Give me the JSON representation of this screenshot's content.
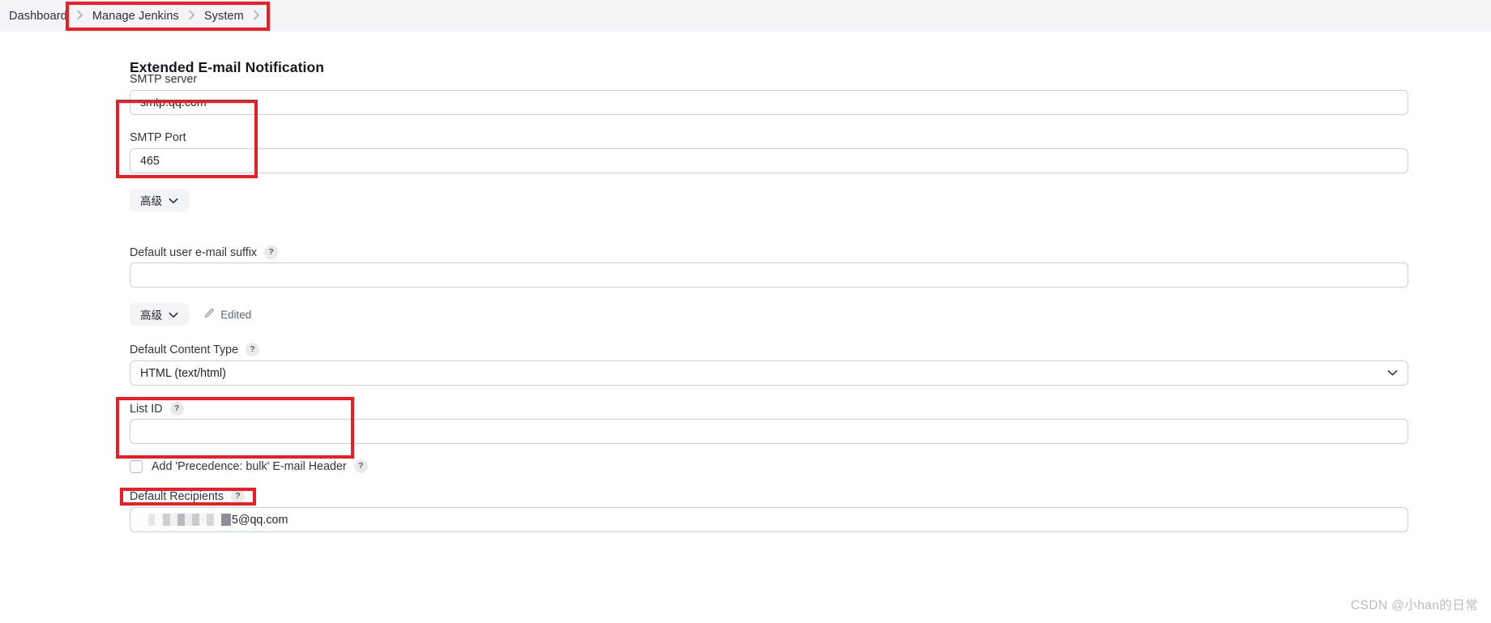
{
  "breadcrumb": {
    "items": [
      {
        "label": "Dashboard"
      },
      {
        "label": "Manage Jenkins"
      },
      {
        "label": "System"
      }
    ],
    "separator_icon": "chevron-right-icon"
  },
  "page": {
    "title": "Extended E-mail Notification"
  },
  "form": {
    "smtp_server": {
      "label": "SMTP server",
      "value": "smtp.qq.com",
      "placeholder": ""
    },
    "smtp_port": {
      "label": "SMTP Port",
      "value": "465",
      "placeholder": ""
    },
    "advanced_button_1": {
      "label": "高级",
      "icon": "chevron-down-icon"
    },
    "default_user_email_suffix": {
      "label": "Default user e-mail suffix",
      "help_icon": "help-icon",
      "value": "",
      "placeholder": ""
    },
    "advanced_button_2": {
      "label": "高级",
      "icon": "chevron-down-icon"
    },
    "edited_tag": {
      "label": "Edited",
      "icon": "pencil-icon"
    },
    "default_content_type": {
      "label": "Default Content Type",
      "help_icon": "help-icon",
      "value": "HTML (text/html)",
      "chevron_icon": "chevron-down-icon",
      "options": [
        "HTML (text/html)"
      ]
    },
    "list_id": {
      "label": "List ID",
      "help_icon": "help-icon",
      "value": "",
      "placeholder": ""
    },
    "precedence_bulk": {
      "label": "Add 'Precedence: bulk' E-mail Header",
      "help_icon": "help-icon",
      "checked": false
    },
    "default_recipients": {
      "label": "Default Recipients",
      "help_icon": "help-icon",
      "value_suffix": "5@qq.com",
      "censored": true
    }
  },
  "annotations": {
    "color": "#ee1c25",
    "boxes": [
      {
        "name": "breadcrumb-highlight"
      },
      {
        "name": "smtp-settings-highlight"
      },
      {
        "name": "default-content-type-highlight"
      },
      {
        "name": "default-recipients-highlight"
      }
    ]
  },
  "watermark": {
    "text": "CSDN @小han的日常"
  }
}
